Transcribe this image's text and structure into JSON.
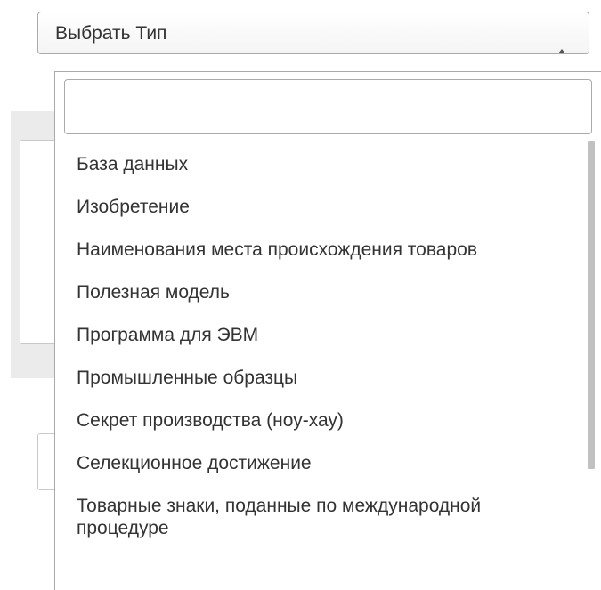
{
  "select": {
    "label": "Выбрать Тип"
  },
  "search": {
    "value": "",
    "placeholder": ""
  },
  "options": [
    "База данных",
    "Изобретение",
    "Наименования места происхождения товаров",
    "Полезная модель",
    "Программа для ЭВМ",
    "Промышленные образцы",
    "Секрет производства (ноу-хау)",
    "Селекционное достижение",
    "Товарные знаки, поданные по международной процедуре"
  ],
  "icons": {
    "caret": "caret-up-icon"
  },
  "colors": {
    "border": "#aaaaaa",
    "text": "#333333",
    "background_panel": "#ebebeb",
    "scroll_thumb": "#c1c1c1"
  }
}
